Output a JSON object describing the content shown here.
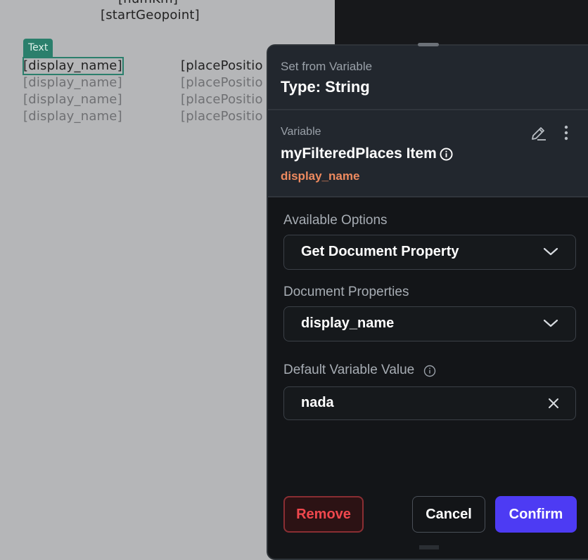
{
  "canvas": {
    "cut_text": "[numKm]",
    "start_geopoint": "[startGeopoint]",
    "selected_tag": "Text",
    "col1": [
      "[display_name]",
      "[display_name]",
      "[display_name]",
      "[display_name]"
    ],
    "col2": [
      "[placePositio",
      "[placePositio",
      "[placePositio",
      "[placePositio"
    ]
  },
  "panel": {
    "subtitle": "Set from Variable",
    "type_label": "Type: String",
    "variable_label": "Variable",
    "variable_name": "myFilteredPlaces Item",
    "variable_field": "display_name",
    "available_options_label": "Available Options",
    "available_options_value": "Get Document Property",
    "document_properties_label": "Document Properties",
    "document_properties_value": "display_name",
    "default_value_label": "Default Variable Value",
    "default_value": "nada",
    "remove_label": "Remove",
    "cancel_label": "Cancel",
    "confirm_label": "Confirm"
  },
  "colors": {
    "accent": "#4d3bf3",
    "field_highlight": "#ee8a5f",
    "danger": "#f0474d",
    "tag": "#2b7f6c"
  },
  "icons": [
    "edit-icon",
    "more-vert-icon",
    "info-icon",
    "chevron-down-icon",
    "close-icon"
  ]
}
